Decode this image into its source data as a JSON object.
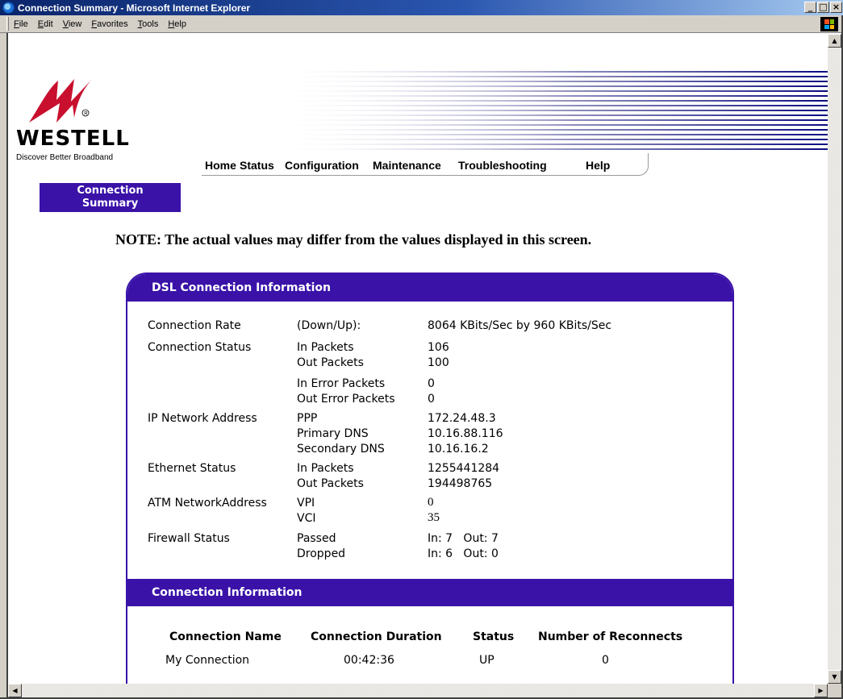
{
  "window": {
    "title": "Connection Summary - Microsoft Internet Explorer"
  },
  "menu": [
    "File",
    "Edit",
    "View",
    "Favorites",
    "Tools",
    "Help"
  ],
  "brand": {
    "name": "WESTELL",
    "tagline": "Discover  Better Broadband"
  },
  "nav": [
    "Home",
    "Status",
    "Configuration",
    "Maintenance",
    "Troubleshooting",
    "Help"
  ],
  "section_tab": {
    "line1": "Connection",
    "line2": "Summary"
  },
  "note": "NOTE: The actual values may differ from the values displayed in this screen.",
  "dsl": {
    "heading": "DSL Connection Information",
    "connection_rate": {
      "label": "Connection Rate",
      "sub": "(Down/Up):",
      "value": "8064 KBits/Sec by 960 KBits/Sec"
    },
    "connection_status": {
      "label": "Connection Status",
      "in_packets_label": "In Packets",
      "in_packets": "106",
      "out_packets_label": "Out Packets",
      "out_packets": "100",
      "in_error_label": "In Error Packets",
      "in_error": "0",
      "out_error_label": "Out Error Packets",
      "out_error": "0"
    },
    "ip": {
      "label": "IP Network Address",
      "ppp_label": "PPP",
      "ppp": "172.24.48.3",
      "primary_dns_label": "Primary DNS",
      "primary_dns": "10.16.88.116",
      "secondary_dns_label": "Secondary DNS",
      "secondary_dns": "10.16.16.2"
    },
    "ethernet": {
      "label": "Ethernet Status",
      "in_label": "In Packets",
      "in": "1255441284",
      "out_label": "Out Packets",
      "out": "194498765"
    },
    "atm": {
      "label": "ATM NetworkAddress",
      "vpi_label": "VPI",
      "vpi": "0",
      "vci_label": "VCI",
      "vci": "35"
    },
    "firewall": {
      "label": "Firewall Status",
      "passed_label": "Passed",
      "passed": "In: 7   Out: 7",
      "dropped_label": "Dropped",
      "dropped": "In: 6   Out: 0"
    }
  },
  "connection_info": {
    "heading": "Connection Information",
    "columns": [
      "Connection Name",
      "Connection Duration",
      "Status",
      "Number of Reconnects"
    ],
    "row": {
      "name": "My Connection",
      "duration": "00:42:36",
      "status": "UP",
      "reconnects": "0"
    }
  },
  "colors": {
    "accent": "#3a12a8",
    "logo_red": "#c8102e"
  },
  "icons": [
    "ie-icon",
    "minimize-icon",
    "maximize-icon",
    "close-icon",
    "windows-logo-icon",
    "westell-logo-icon",
    "scroll-up-icon",
    "scroll-down-icon",
    "scroll-left-icon",
    "scroll-right-icon"
  ]
}
